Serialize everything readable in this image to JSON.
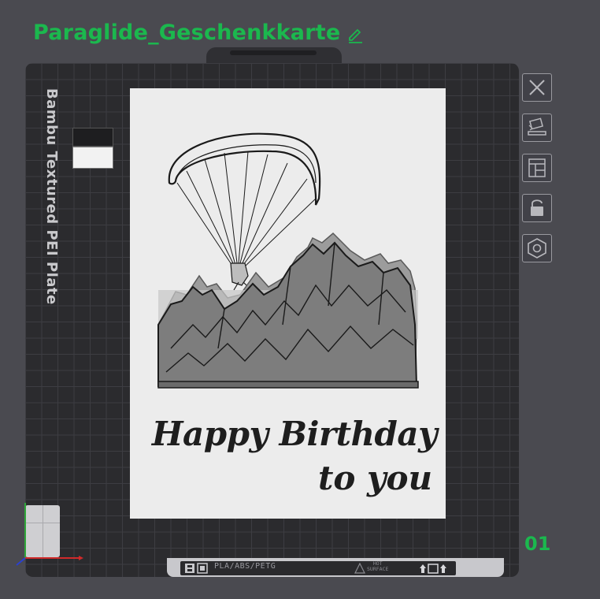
{
  "header": {
    "project_title": "Paraglide_Geschenkkarte"
  },
  "plate": {
    "name": "Bambu Textured PEI Plate",
    "number": "01",
    "filament_info": "PLA/ABS/PETG",
    "hot_surface_warning": "HOT\nSURFACE",
    "filament_colors": [
      "#1e1e20",
      "#f2f2f2"
    ]
  },
  "card": {
    "line1": "Happy Birthday",
    "line2": "to you"
  },
  "toolbar": {
    "buttons": [
      {
        "name": "close-icon"
      },
      {
        "name": "auto-orient-icon"
      },
      {
        "name": "arrange-icon"
      },
      {
        "name": "lock-icon"
      },
      {
        "name": "settings-icon"
      }
    ]
  },
  "colors": {
    "accent": "#1bb84e",
    "background": "#4a4a50",
    "plate": "#2b2b2e"
  }
}
